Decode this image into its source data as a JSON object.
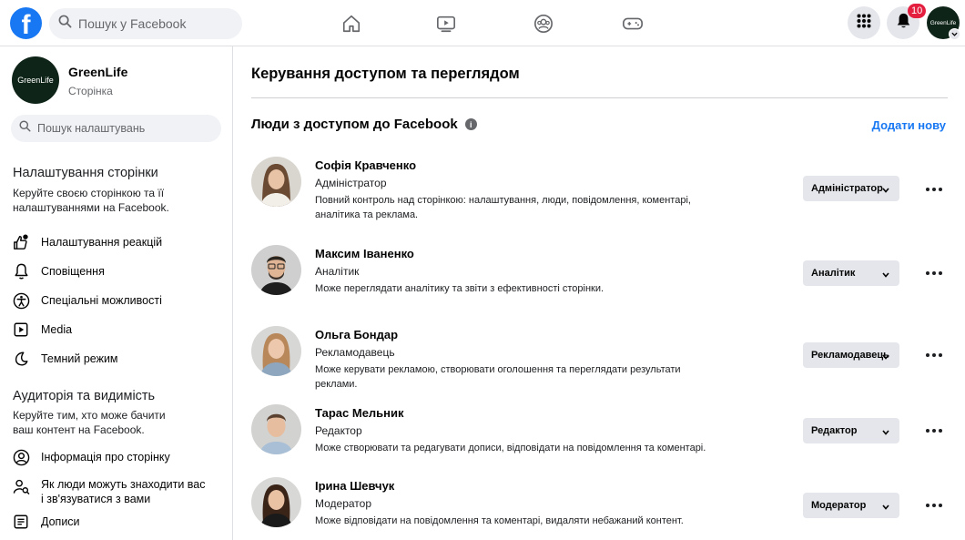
{
  "topbar": {
    "logo": "f",
    "search_placeholder": "Пошук у Facebook",
    "nav_icons": [
      "home-icon",
      "video-icon",
      "groups-icon",
      "gaming-icon"
    ],
    "notifications_count": "10",
    "avatar_text": "GreenLife"
  },
  "sidebar": {
    "page_avatar_text": "GreenLife",
    "page_name": "GreenLife",
    "page_type": "Сторінка",
    "search_placeholder": "Пошук налаштувань",
    "section1_title": "Налаштування сторінки",
    "section1_desc": "Керуйте своєю сторінкою та її налаштуваннями на Facebook.",
    "items1": [
      {
        "label": "Налаштування реакцій",
        "icon": "reactions-icon"
      },
      {
        "label": "Сповіщення",
        "icon": "bell-icon"
      },
      {
        "label": "Спеціальні можливості",
        "icon": "accessibility-icon"
      },
      {
        "label": "Media",
        "icon": "media-icon"
      },
      {
        "label": "Темний режим",
        "icon": "moon-icon"
      }
    ],
    "section2_title": "Аудиторія та видимість",
    "section2_desc": "Керуйте тим, хто може бачити ваш контент на Facebook.",
    "items2": [
      {
        "label": "Інформація про сторінку",
        "icon": "profile-icon"
      },
      {
        "label": "Як люди можуть знаходити вас і зв'язуватися з вами",
        "icon": "people-search-icon"
      },
      {
        "label": "Дописи",
        "icon": "posts-icon"
      }
    ]
  },
  "main": {
    "title": "Керування доступом та переглядом",
    "subtitle": "Люди з доступом до Facebook",
    "add_new": "Додати нову",
    "people": [
      {
        "name": "Софія Кравченко",
        "role": "Адміністратор",
        "desc": "Повний контроль над сторінкою: налаштування, люди, повідомлення, коментарі, аналітика та реклама.",
        "role_button": "Адміністратор"
      },
      {
        "name": "Максим Іваненко",
        "role": "Аналітик",
        "desc": "Може переглядати аналітику та звіти з ефективності сторінки.",
        "role_button": "Аналітик"
      },
      {
        "name": "Ольга Бондар",
        "role": "Рекламодавець",
        "desc": "Може керувати рекламою, створювати оголошення та переглядати результати реклами.",
        "role_button": "Рекламодавець"
      },
      {
        "name": "Тарас Мельник",
        "role": "Редактор",
        "desc": "Може створювати та редагувати дописи, відповідати на повідомлення та коментарі.",
        "role_button": "Редактор"
      },
      {
        "name": "Ірина Шевчук",
        "role": "Модератор",
        "desc": "Може відповідати на повідомлення та коментарі, видаляти небажаний контент.",
        "role_button": "Модератор"
      }
    ]
  }
}
